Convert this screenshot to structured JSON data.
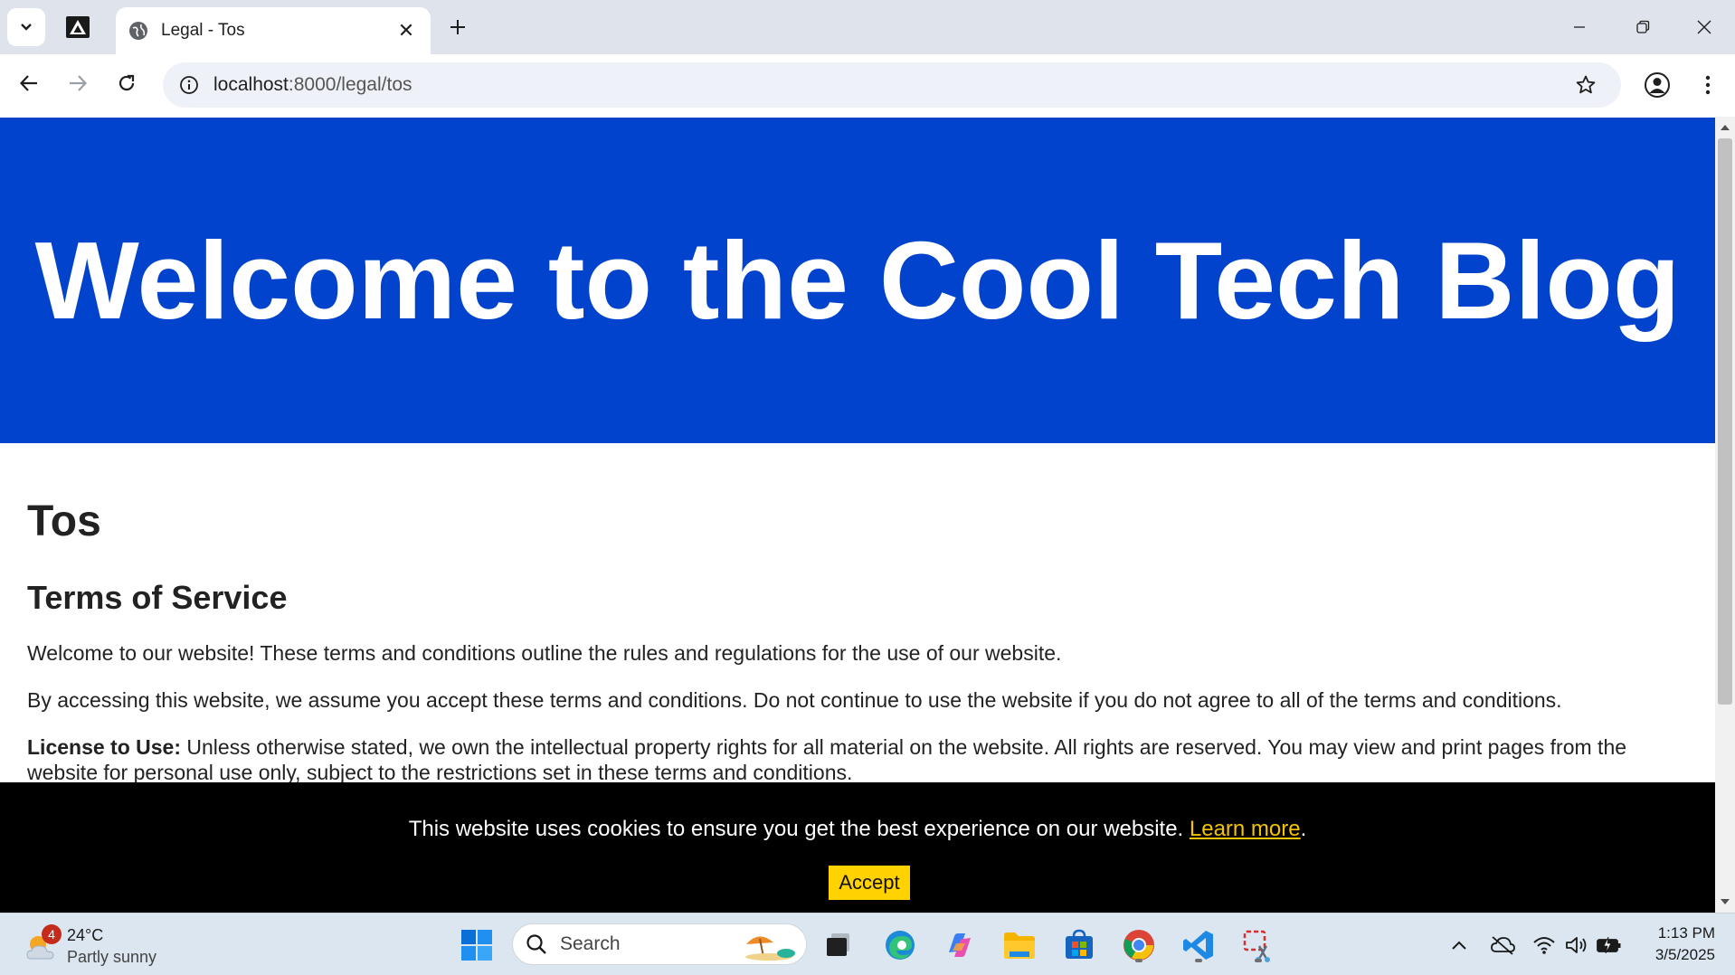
{
  "browser": {
    "tab_title": "Legal - Tos",
    "url_host": "localhost",
    "url_path": ":8000/legal/tos",
    "new_tab_symbol": "+",
    "close_symbol": "✕"
  },
  "page": {
    "hero_title": "Welcome to the Cool Tech Blog",
    "heading": "Tos",
    "subheading": "Terms of Service",
    "paragraphs": [
      "Welcome to our website! These terms and conditions outline the rules and regulations for the use of our website.",
      "By accessing this website, we assume you accept these terms and conditions. Do not continue to use the website if you do not agree to all of the terms and conditions."
    ],
    "license_label": "License to Use:",
    "license_text": " Unless otherwise stated, we own the intellectual property rights for all material on the website. All rights are reserved. You may view and print pages from the website for personal use only, subject to the restrictions set in these terms and conditions."
  },
  "cookie_banner": {
    "message": "This website uses cookies to ensure you get the best experience on our website. ",
    "link_label": "Learn more",
    "suffix": ".",
    "accept_label": "Accept"
  },
  "taskbar": {
    "weather_badge": "4",
    "weather_temp": "24°C",
    "weather_desc": "Partly sunny",
    "search_label": "Search",
    "time": "1:13 PM",
    "date": "3/5/2025"
  },
  "colors": {
    "hero_bg": "#0143cc",
    "cookie_bg": "#000000",
    "link": "#f5c400",
    "accept_bg": "#ffd200"
  }
}
